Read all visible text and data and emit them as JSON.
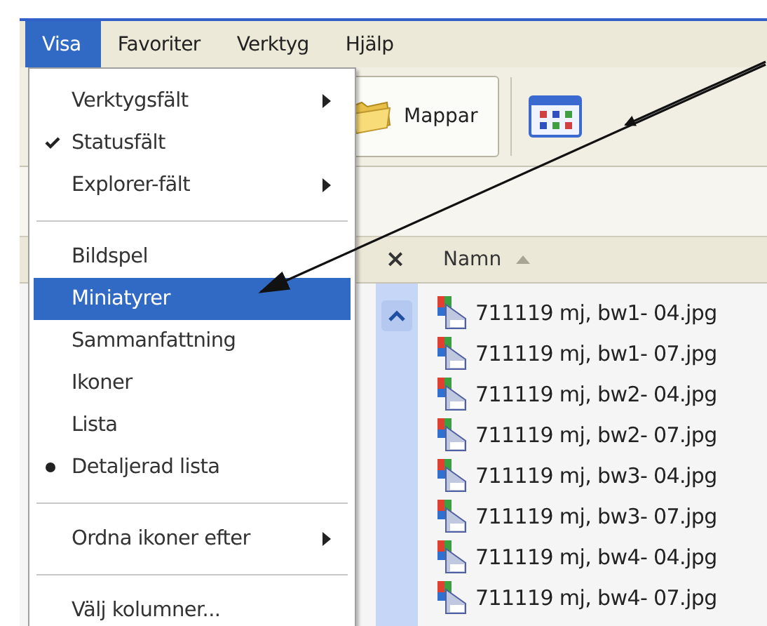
{
  "menu_bar": [
    {
      "label": "Visa",
      "selected": true
    },
    {
      "label": "Favoriter",
      "selected": false
    },
    {
      "label": "Verktyg",
      "selected": false
    },
    {
      "label": "Hjälp",
      "selected": false
    }
  ],
  "view_menu": [
    {
      "kind": "item",
      "label": "Verktygsfält",
      "submenu": true,
      "selected": false
    },
    {
      "kind": "item",
      "label": "Statusfält",
      "checked": true,
      "selected": false
    },
    {
      "kind": "item",
      "label": "Explorer-fält",
      "submenu": true,
      "selected": false
    },
    {
      "kind": "separator"
    },
    {
      "kind": "item",
      "label": "Bildspel",
      "selected": false
    },
    {
      "kind": "item",
      "label": "Miniatyrer",
      "selected": true
    },
    {
      "kind": "item",
      "label": "Sammanfattning",
      "selected": false
    },
    {
      "kind": "item",
      "label": "Ikoner",
      "selected": false
    },
    {
      "kind": "item",
      "label": "Lista",
      "selected": false
    },
    {
      "kind": "item",
      "label": "Detaljerad lista",
      "radio": true,
      "selected": false
    },
    {
      "kind": "separator"
    },
    {
      "kind": "item",
      "label": "Ordna ikoner efter",
      "submenu": true,
      "selected": false
    },
    {
      "kind": "separator"
    },
    {
      "kind": "item",
      "label": "Välj kolumner...",
      "selected": false
    }
  ],
  "toolbar": {
    "folders_button": "Mappar"
  },
  "file_list": {
    "close": "×",
    "column": "Namn",
    "sorted_ascending": true,
    "files": [
      "711119 mj, bw1- 04.jpg",
      "711119 mj, bw1- 07.jpg",
      "711119 mj, bw2- 04.jpg",
      "711119 mj, bw2- 07.jpg",
      "711119 mj, bw3- 04.jpg",
      "711119 mj, bw3- 07.jpg",
      "711119 mj, bw4- 04.jpg",
      "711119 mj, bw4- 07.jpg"
    ]
  }
}
